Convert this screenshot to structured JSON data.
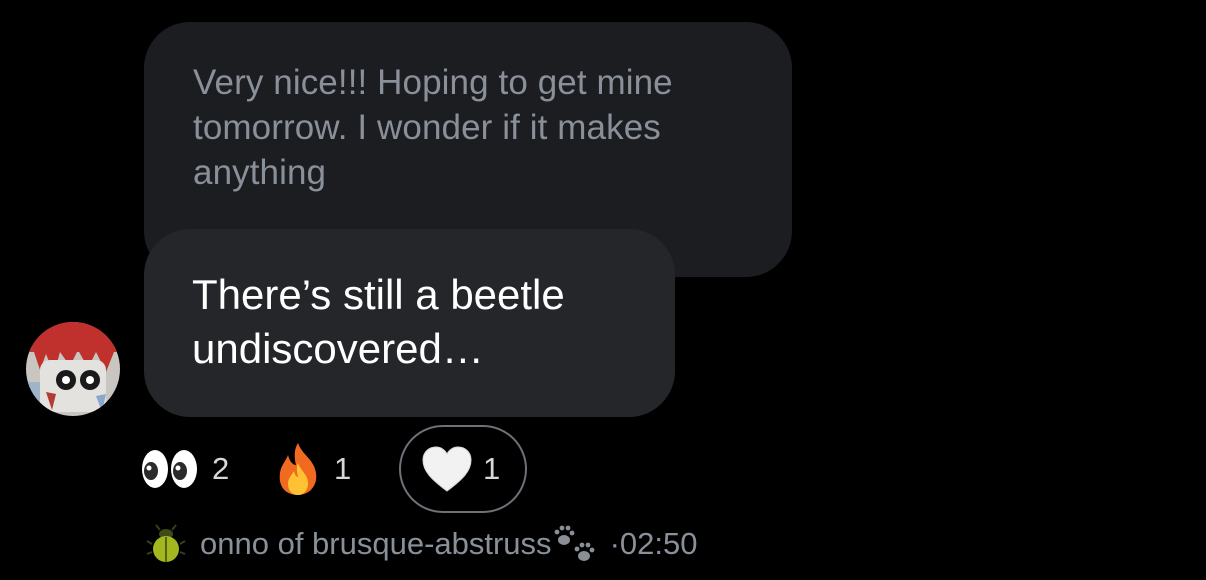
{
  "quoted_message": {
    "text": "Very nice!!! Hoping to get mine tomorrow. I wonder if it makes anything"
  },
  "message": {
    "text": "There’s still a beetle undiscovered…"
  },
  "avatar": {
    "icon": "avatar-icon"
  },
  "reactions": [
    {
      "emoji": "eyes",
      "count": "2"
    },
    {
      "emoji": "fire",
      "count": "1"
    },
    {
      "emoji": "white-heart",
      "count": "1"
    }
  ],
  "footer": {
    "sender_icon": "beetle-icon",
    "sender": "onno of brusque-abstruss",
    "trail_icon": "paw-prints-icon",
    "separator": "·",
    "time": "02:50"
  },
  "colors": {
    "background": "#000000",
    "quote_bubble": "#1b1d21",
    "message_bubble": "#24262a",
    "muted_text": "#8a9099"
  }
}
